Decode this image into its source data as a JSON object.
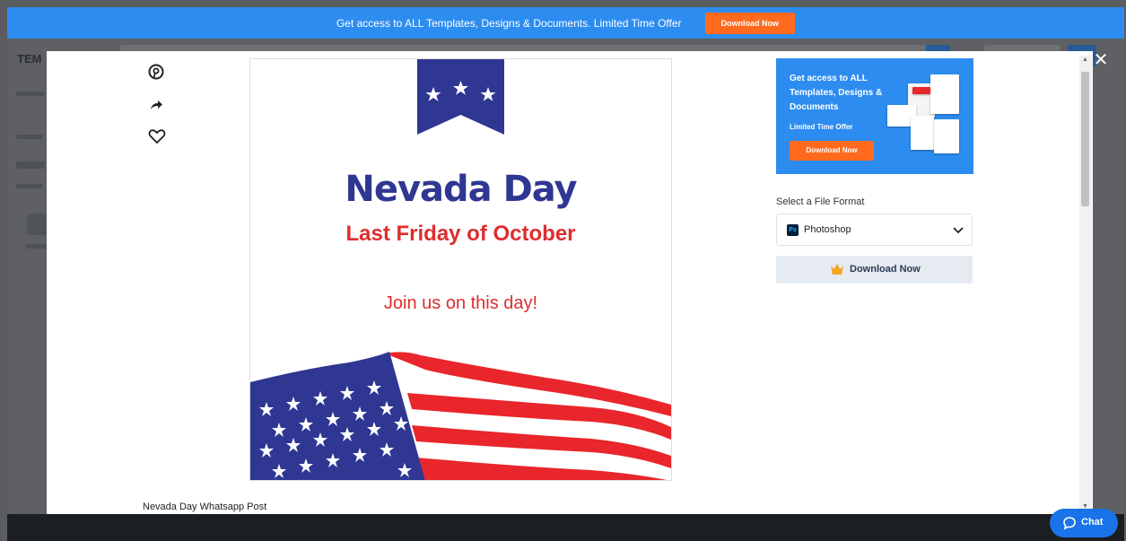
{
  "promo_bar": {
    "text": "Get access to ALL Templates, Designs & Documents. Limited Time Offer",
    "button": "Download Now"
  },
  "background": {
    "page_title_partial": "TEM"
  },
  "modal": {
    "preview": {
      "title": "Nevada Day",
      "subtitle": "Last Friday of October",
      "tagline": "Join us on this day!"
    },
    "caption": "Nevada Day Whatsapp Post",
    "side_icons": [
      "pinterest-icon",
      "share-icon",
      "heart-icon"
    ],
    "ad": {
      "text": "Get access to ALL Templates, Designs & Documents",
      "subtext": "Limited Time Offer",
      "button": "Download Now"
    },
    "format_label": "Select a File Format",
    "format_selected": "Photoshop",
    "format_icon_text": "Ps",
    "download_button": "Download Now",
    "close_icon": "close-icon"
  },
  "chat": {
    "label": "Chat"
  },
  "colors": {
    "brand_blue": "#2d8cf0",
    "cta_orange": "#ff6a1f",
    "navy": "#2f3793",
    "red": "#de2d2d"
  }
}
